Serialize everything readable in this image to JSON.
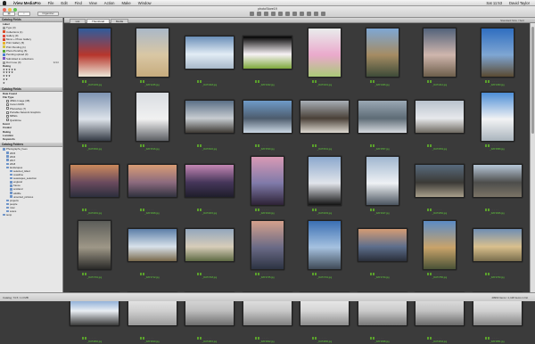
{
  "menubar": {
    "app_name": "iView MediaPro",
    "items": [
      "File",
      "Edit",
      "Find",
      "View",
      "Action",
      "Make",
      "Window"
    ],
    "right_items": [
      "Sat 11:53",
      "David Taylor"
    ]
  },
  "window": {
    "title": "photoStore19"
  },
  "toolbar": {
    "view_buttons": [
      "List",
      "Thumbnail",
      "Media"
    ],
    "organizer_label": "Organizer"
  },
  "sidebar": {
    "catalog_fields_title": "Catalog Fields",
    "label_section": "Label",
    "labels": [
      {
        "name": "Type (3)",
        "color": "#9a9a9a",
        "count": ""
      },
      {
        "name": "Collections (1)",
        "color": "#d94f2a",
        "count": ""
      },
      {
        "name": "Gallery (9)",
        "color": "#e04a3c",
        "count": ""
      },
      {
        "name": "Mono + Photo Gallery",
        "color": "#d9452f",
        "count": ""
      },
      {
        "name": "Print Gallery (5)",
        "color": "#e8b32a",
        "count": ""
      },
      {
        "name": "Print Pending (1)",
        "color": "#d5c43b",
        "count": ""
      },
      {
        "name": "Photo Pending (5)",
        "color": "#58a83a",
        "count": ""
      },
      {
        "name": "Pending upload (0)",
        "color": "#4a7fd1",
        "count": ""
      },
      {
        "name": "Submitted to collections",
        "color": "#7b58c2",
        "count": ""
      },
      {
        "name": "Don't use (0)",
        "color": "#9a9a9a",
        "count": "3210"
      }
    ],
    "rating_section": "Rating",
    "ratings": [
      "★★★★★",
      "★★★★",
      "★★★",
      "★★",
      "★"
    ],
    "catalog_fields_label": "Catalog Fields",
    "info_sections": [
      "Date Found",
      "File Type"
    ],
    "file_types": [
      "JPEG Image (38)",
      "Canon RAW",
      "Photoshop (7)",
      "Portable Network Graphics",
      "MPEG",
      "Quicktime"
    ],
    "more_sections": [
      "Event",
      "Creator",
      "Rating",
      "Location",
      "Keywords"
    ],
    "folders_title": "Catalog Folders",
    "folders": [
      {
        "name": "Photographs_Fees",
        "depth": 0
      },
      {
        "name": "2015",
        "depth": 1
      },
      {
        "name": "2016",
        "depth": 1
      },
      {
        "name": "2017",
        "depth": 1
      },
      {
        "name": "2018",
        "depth": 1
      },
      {
        "name": "landscapes",
        "depth": 1
      },
      {
        "name": "selected_tidied",
        "depth": 2
      },
      {
        "name": "coastline",
        "depth": 2
      },
      {
        "name": "seascapes_selection",
        "depth": 2
      },
      {
        "name": "england",
        "depth": 2
      },
      {
        "name": "france",
        "depth": 2
      },
      {
        "name": "scotland",
        "depth": 2
      },
      {
        "name": "wildlife",
        "depth": 2
      },
      {
        "name": "unsorted_pictures",
        "depth": 2
      },
      {
        "name": "projects",
        "depth": 1
      },
      {
        "name": "people",
        "depth": 1
      },
      {
        "name": "misc",
        "depth": 1
      },
      {
        "name": "scans",
        "depth": 1
      },
      {
        "name": "temp",
        "depth": 0
      }
    ]
  },
  "browser": {
    "tabs": [
      "List",
      "Thumbnail",
      "Media"
    ],
    "active_tab": "Thumbnail",
    "sort_label": "Standard Size / Sort",
    "thumbnails": [
      {
        "file": "_DAT1203.jpg",
        "colors": [
          "#2f5c9c",
          "#b7362c",
          "#ede7d8"
        ],
        "orient": "p"
      },
      {
        "file": "_DAT1245.jpg",
        "colors": [
          "#aab8c8",
          "#d9c7a4",
          "#c6ab7d"
        ],
        "orient": "p"
      },
      {
        "file": "_DAT1318.jpg",
        "colors": [
          "#6b8fb8",
          "#e2ecf5",
          "#a8b9c9"
        ],
        "orient": "l"
      },
      {
        "file": "_DAT1322.jpg",
        "colors": [
          "#020202",
          "#f7f2f5",
          "#7ea83c"
        ],
        "orient": "l"
      },
      {
        "file": "_DAT1331.jpg",
        "colors": [
          "#e9ecec",
          "#eaa9cc",
          "#aaca78"
        ],
        "orient": "p"
      },
      {
        "file": "_DAT1406.jpg",
        "colors": [
          "#7ea7d4",
          "#a58c63",
          "#3e4b38"
        ],
        "orient": "p"
      },
      {
        "file": "_DAT1412.jpg",
        "colors": [
          "#52627a",
          "#cfb6ad",
          "#6d5e4b"
        ],
        "orient": "p"
      },
      {
        "file": "_DAT1453.jpg",
        "colors": [
          "#2f6ec0",
          "#7fa6d3",
          "#5a4a32"
        ],
        "orient": "p"
      },
      {
        "file": "_DAT1502.jpg",
        "colors": [
          "#7e94b2",
          "#dde3ea",
          "#353b45"
        ],
        "orient": "p"
      },
      {
        "file": "_DAT1516.jpg",
        "colors": [
          "#d9dde2",
          "#f1f1f1",
          "#5c5f64"
        ],
        "orient": "p"
      },
      {
        "file": "_DAT1522.jpg",
        "colors": [
          "#5a6f86",
          "#c7ccd1",
          "#3e3a34"
        ],
        "orient": "l"
      },
      {
        "file": "_DAT1530.jpg",
        "colors": [
          "#6f9bc9",
          "#4d5c6d",
          "#cbd8e4"
        ],
        "orient": "l"
      },
      {
        "file": "_DAT1541.jpg",
        "colors": [
          "#a8afb6",
          "#4a4138",
          "#ded9d1"
        ],
        "orient": "l"
      },
      {
        "file": "_DAT1557.jpg",
        "colors": [
          "#9aa8b4",
          "#5e6c76",
          "#d6dadf"
        ],
        "orient": "l"
      },
      {
        "file": "_DAT1563.jpg",
        "colors": [
          "#b9c2cd",
          "#e7e9ec",
          "#6f6a62"
        ],
        "orient": "l"
      },
      {
        "file": "_DAT1580.jpg",
        "colors": [
          "#4d8ed6",
          "#f2f3f4",
          "#a9b4bd"
        ],
        "orient": "p"
      },
      {
        "file": "_DAT1601.jpg",
        "colors": [
          "#cc8a5c",
          "#6a4a5e",
          "#2c2f3d"
        ],
        "orient": "l"
      },
      {
        "file": "_DAT1608.jpg",
        "colors": [
          "#d99d75",
          "#8b6a7e",
          "#31323e"
        ],
        "orient": "l"
      },
      {
        "file": "_DAT1615.jpg",
        "colors": [
          "#c487b4",
          "#45365a",
          "#1f1e2b"
        ],
        "orient": "l"
      },
      {
        "file": "_DAT1620.jpg",
        "colors": [
          "#d89ab5",
          "#7f7aa9",
          "#2d2236"
        ],
        "orient": "p"
      },
      {
        "file": "_DAT1633.jpg",
        "colors": [
          "#8ba8cd",
          "#e1e4ea",
          "#141414"
        ],
        "orient": "p"
      },
      {
        "file": "_DAT1647.jpg",
        "colors": [
          "#a0b6cf",
          "#eef1f4",
          "#4b5560"
        ],
        "orient": "p"
      },
      {
        "file": "_DAT1652.jpg",
        "colors": [
          "#586a7d",
          "#3b3a36",
          "#a99f8b"
        ],
        "orient": "l"
      },
      {
        "file": "_DAT1666.jpg",
        "colors": [
          "#b7c7d8",
          "#4d4d4b",
          "#7b7466"
        ],
        "orient": "l"
      },
      {
        "file": "_DAT1701.jpg",
        "colors": [
          "#5d5e5a",
          "#9e9787",
          "#2a2a28"
        ],
        "orient": "p"
      },
      {
        "file": "_DAT1712.jpg",
        "colors": [
          "#5c7ea8",
          "#d8e1ea",
          "#7a6a4c"
        ],
        "orient": "l"
      },
      {
        "file": "_DAT1718.jpg",
        "colors": [
          "#93a6bd",
          "#d7cdb9",
          "#5f6b44"
        ],
        "orient": "l"
      },
      {
        "file": "_DAT1725.jpg",
        "colors": [
          "#d5a18c",
          "#6a6a86",
          "#2c3342"
        ],
        "orient": "p"
      },
      {
        "file": "_DAT1731.jpg",
        "colors": [
          "#3a6fb3",
          "#a6c2e0",
          "#3f4a56"
        ],
        "orient": "p"
      },
      {
        "file": "_DAT1744.jpg",
        "colors": [
          "#d49c74",
          "#5d6e8c",
          "#2a2f3a"
        ],
        "orient": "l"
      },
      {
        "file": "_DAT1750.jpg",
        "colors": [
          "#5b8bc5",
          "#c9a36a",
          "#4a5236"
        ],
        "orient": "p"
      },
      {
        "file": "_DAT1763.jpg",
        "colors": [
          "#6f8eb4",
          "#d9c08d",
          "#7a6e4d"
        ],
        "orient": "l"
      },
      {
        "file": "_DAT1802.jpg",
        "colors": [
          "#4c80c4",
          "#e9eef3",
          "#3b3b3b"
        ],
        "orient": "l"
      },
      {
        "file": "_DAT1810.jpg",
        "colors": [
          "#f2f2f2",
          "#cfcfcf",
          "#9a9a9a"
        ],
        "orient": "l"
      },
      {
        "file": "_DAT1815.jpg",
        "colors": [
          "#e5e5e5",
          "#bdbdbd",
          "#6e6e6e"
        ],
        "orient": "l"
      },
      {
        "file": "_DAT1822.jpg",
        "colors": [
          "#efefef",
          "#c7c7c7",
          "#808080"
        ],
        "orient": "l"
      },
      {
        "file": "_DAT1830.jpg",
        "colors": [
          "#f4f4f4",
          "#d5d5d5",
          "#8d8d8d"
        ],
        "orient": "l"
      },
      {
        "file": "_DAT1838.jpg",
        "colors": [
          "#f0f0f0",
          "#cacaca",
          "#777777"
        ],
        "orient": "l"
      },
      {
        "file": "_DAT1844.jpg",
        "colors": [
          "#ececec",
          "#c2c2c2",
          "#6a6a6a"
        ],
        "orient": "l"
      },
      {
        "file": "_DAT1851.jpg",
        "colors": [
          "#f3f3f3",
          "#d0d0d0",
          "#858585"
        ],
        "orient": "l"
      }
    ]
  },
  "statusbar": {
    "left": "Catalog: 74.5 / 1.3 MB",
    "right": "40963 Items / 1,128 items in list"
  }
}
